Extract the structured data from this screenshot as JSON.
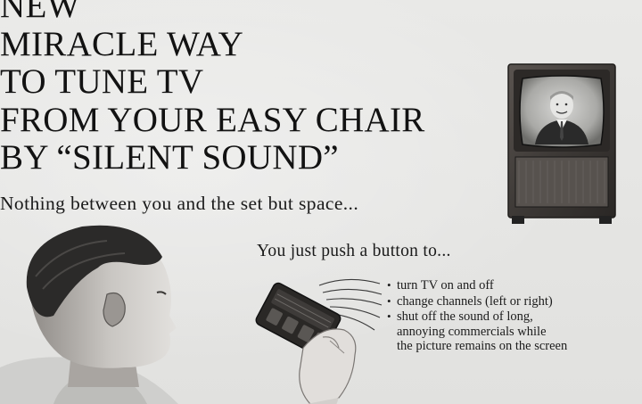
{
  "ad": {
    "headline_lines": [
      "NEW",
      "MIRACLE WAY",
      "TO TUNE TV",
      "FROM YOUR EASY CHAIR",
      "BY “SILENT SOUND”"
    ],
    "subhead": "Nothing between you and the set but space...",
    "intro": "You just push a button to...",
    "features": [
      "turn TV on and off",
      "change channels (left or right)",
      "shut off the sound of long,\nannoying commercials while\nthe picture remains on the screen"
    ]
  }
}
